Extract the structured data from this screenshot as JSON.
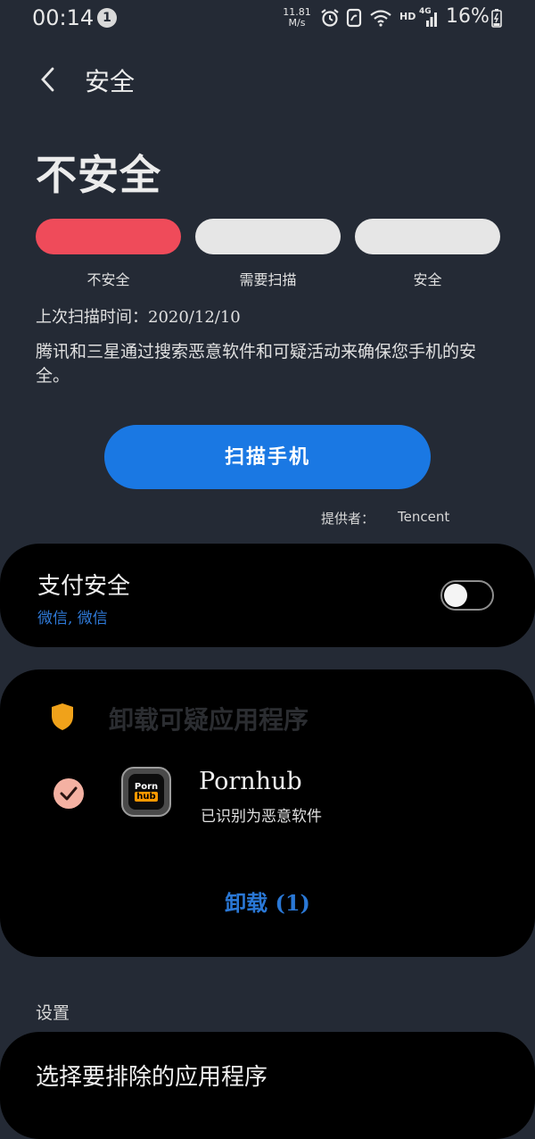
{
  "status_bar": {
    "time": "00:14",
    "notification_count": "1",
    "net_speed_value": "11.81",
    "net_speed_unit": "M/s",
    "hd_label": "HD",
    "network": "4G",
    "battery": "16%",
    "icons": [
      "alarm-icon",
      "nfc-icon",
      "wifi-icon",
      "signal-icon",
      "battery-icon"
    ]
  },
  "header": {
    "title": "安全"
  },
  "security": {
    "status": "不安全",
    "segments": [
      {
        "label": "不安全",
        "color": "#ef4b5a"
      },
      {
        "label": "需要扫描",
        "color": "#e6e6e6"
      },
      {
        "label": "安全",
        "color": "#e6e6e6"
      }
    ],
    "last_scan": "上次扫描时间：2020/12/10",
    "description": "腾讯和三星通过搜索恶意软件和可疑活动来确保您手机的安全。",
    "scan_button": "扫描手机",
    "provider_label": "提供者：",
    "provider_value": "Tencent"
  },
  "payment": {
    "title": "支付安全",
    "subtitle": "微信, 微信",
    "toggle_on": false
  },
  "suspicious": {
    "title": "卸载可疑应用程序",
    "app": {
      "name": "Pornhub",
      "status": "已识别为恶意软件",
      "icon_text_1": "Porn",
      "icon_text_2": "hub",
      "checked": true
    },
    "uninstall_button": "卸载 (1)"
  },
  "settings": {
    "section_label": "设置",
    "exclude_apps": "选择要排除的应用程序"
  },
  "colors": {
    "background": "#242a35",
    "card": "#000000",
    "accent_blue": "#1a78e3",
    "danger": "#ef4b5a"
  }
}
